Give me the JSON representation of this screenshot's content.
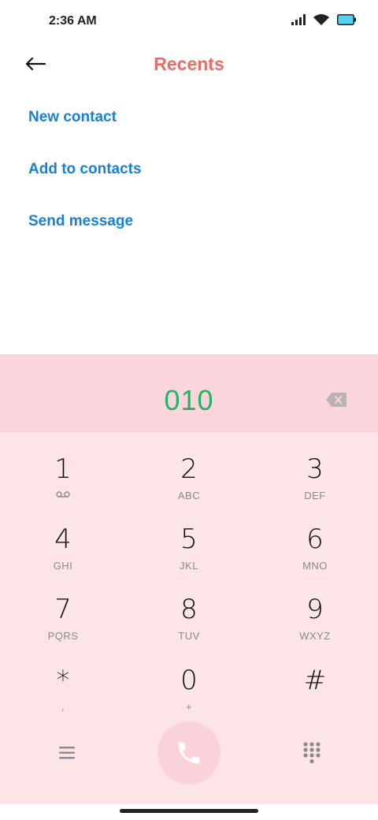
{
  "status_bar": {
    "time": "2:36 AM",
    "icons": [
      "signal-icon",
      "wifi-icon",
      "battery-icon"
    ]
  },
  "header": {
    "title": "Recents",
    "back_icon": "arrow-left-icon"
  },
  "actions": [
    {
      "label": "New contact"
    },
    {
      "label": "Add to contacts"
    },
    {
      "label": "Send message"
    }
  ],
  "dialer": {
    "number": "010",
    "backspace_icon": "backspace-icon"
  },
  "keys": [
    {
      "digit": "1",
      "letters": ""
    },
    {
      "digit": "2",
      "letters": "ABC"
    },
    {
      "digit": "3",
      "letters": "DEF"
    },
    {
      "digit": "4",
      "letters": "GHI"
    },
    {
      "digit": "5",
      "letters": "JKL"
    },
    {
      "digit": "6",
      "letters": "MNO"
    },
    {
      "digit": "7",
      "letters": "PQRS"
    },
    {
      "digit": "8",
      "letters": "TUV"
    },
    {
      "digit": "9",
      "letters": "WXYZ"
    },
    {
      "digit": "*",
      "letters": ","
    },
    {
      "digit": "0",
      "letters": "+"
    },
    {
      "digit": "#",
      "letters": ""
    }
  ],
  "bottom_bar": {
    "menu_icon": "menu-icon",
    "call_icon": "phone-icon",
    "dialpad_icon": "dialpad-icon"
  },
  "colors": {
    "title": "#f06a66",
    "link": "#1a7fd6",
    "number": "#22b562",
    "keypad_bg": "#fce4e7",
    "display_bg": "#fad6dc"
  }
}
